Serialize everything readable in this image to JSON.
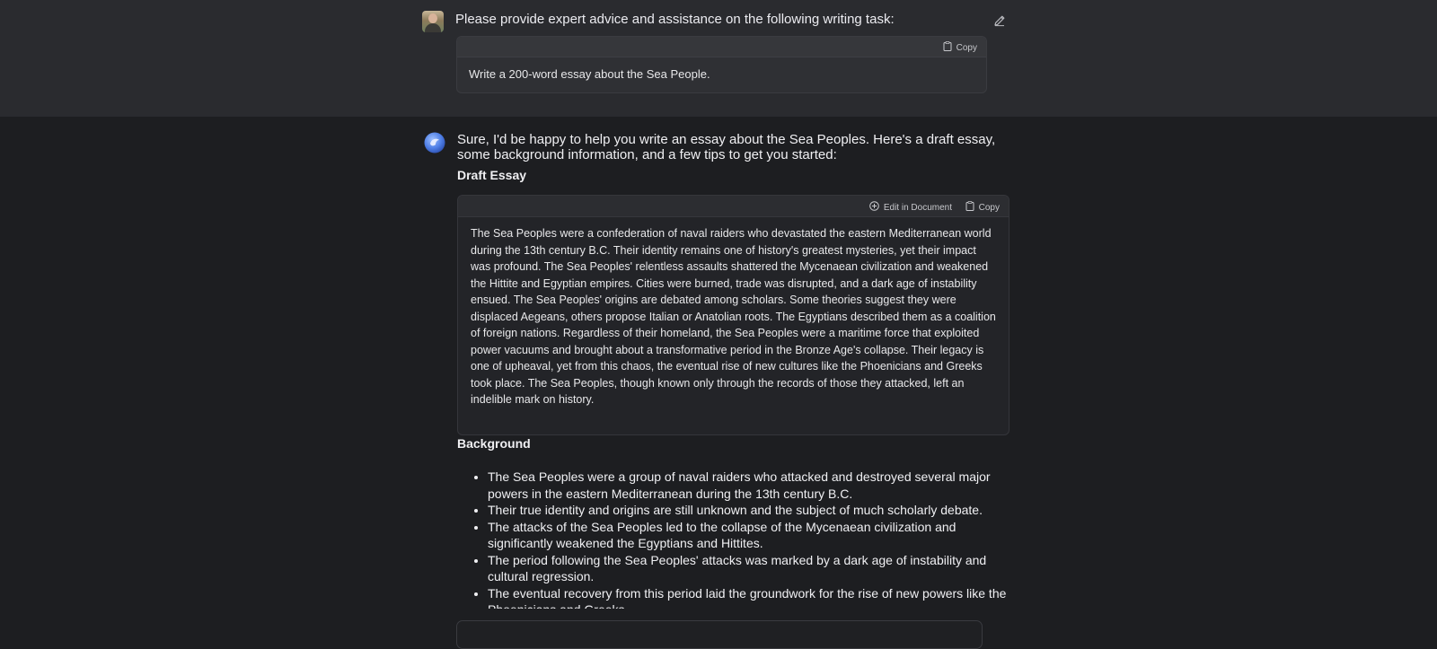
{
  "user": {
    "message": "Please provide expert advice and assistance on the following writing task:",
    "code_box": {
      "copy_label": "Copy",
      "text": "Write a 200-word essay about the Sea People."
    }
  },
  "assistant": {
    "intro": "Sure, I'd be happy to help you write an essay about the Sea Peoples. Here's a draft essay, some background information, and a few tips to get you started:",
    "draft_heading": "Draft Essay",
    "essay_box": {
      "edit_label": "Edit in Document",
      "copy_label": "Copy",
      "text": "The Sea Peoples were a confederation of naval raiders who devastated the eastern Mediterranean world during the 13th century B.C. Their identity remains one of history's greatest mysteries, yet their impact was profound. The Sea Peoples' relentless assaults shattered the Mycenaean civilization and weakened the Hittite and Egyptian empires. Cities were burned, trade was disrupted, and a dark age of instability ensued. The Sea Peoples' origins are debated among scholars. Some theories suggest they were displaced Aegeans, others propose Italian or Anatolian roots. The Egyptians described them as a coalition of foreign nations. Regardless of their homeland, the Sea Peoples were a maritime force that exploited power vacuums and brought about a transformative period in the Bronze Age's collapse. Their legacy is one of upheaval, yet from this chaos, the eventual rise of new cultures like the Phoenicians and Greeks took place. The Sea Peoples, though known only through the records of those they attacked, left an indelible mark on history."
    },
    "background_heading": "Background",
    "background_items": [
      "The Sea Peoples were a group of naval raiders who attacked and destroyed several major powers in the eastern Mediterranean during the 13th century B.C.",
      "Their true identity and origins are still unknown and the subject of much scholarly debate.",
      "The attacks of the Sea Peoples led to the collapse of the Mycenaean civilization and significantly weakened the Egyptians and Hittites.",
      "The period following the Sea Peoples' attacks was marked by a dark age of instability and cultural regression.",
      "The eventual recovery from this period laid the groundwork for the rise of new powers like the Phoenicians and Greeks."
    ]
  },
  "icons": {
    "edit": "pencil-icon",
    "copy": "clipboard-icon",
    "edit_document": "plus-circle-icon",
    "assistant_avatar": "assistant-logo-icon"
  },
  "colors": {
    "user_bg": "#2a2b2f",
    "page_bg": "#1d1e21",
    "assistant_accent": "#4f7fe6"
  }
}
